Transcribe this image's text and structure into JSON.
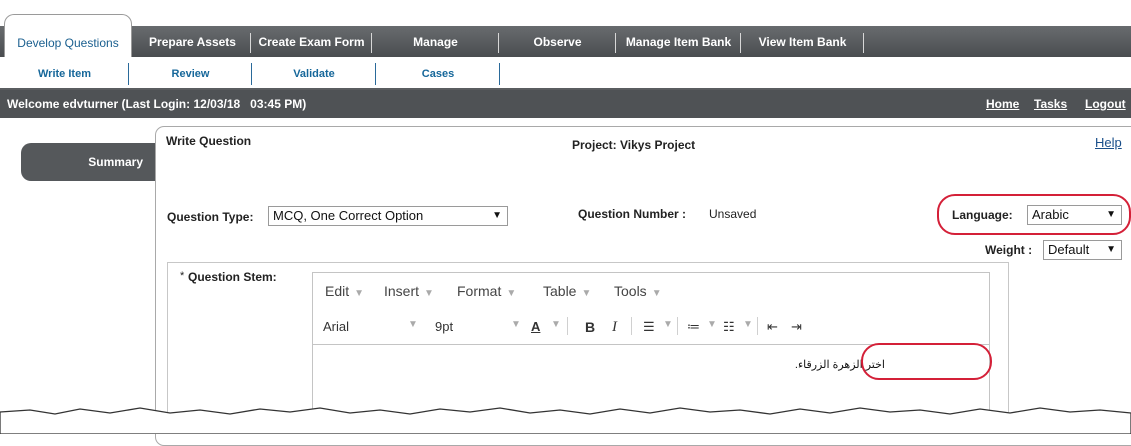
{
  "main_tabs": [
    {
      "label": "Develop Questions",
      "active": true
    },
    {
      "label": "Prepare Assets"
    },
    {
      "label": "Create Exam Form"
    },
    {
      "label": "Manage"
    },
    {
      "label": "Observe"
    },
    {
      "label": "Manage Item Bank"
    },
    {
      "label": "View Item Bank"
    }
  ],
  "sub_tabs": [
    {
      "label": "Write Item"
    },
    {
      "label": "Review"
    },
    {
      "label": "Validate"
    },
    {
      "label": "Cases"
    }
  ],
  "welcome": {
    "message": "Welcome edvturner (Last Login: 12/03/18   03:45 PM)",
    "links": [
      "Home",
      "Tasks",
      "Logout"
    ]
  },
  "sidebar": {
    "summary_label": "Summary"
  },
  "panel": {
    "title": "Write Question",
    "project": "Project: Vikys Project",
    "help_label": "Help",
    "question_type_label": "Question Type:",
    "question_type_value": "MCQ, One Correct Option",
    "question_number_label": "Question Number :",
    "question_number_value": "Unsaved",
    "language_label": "Language:",
    "language_value": "Arabic",
    "weight_label": "Weight :",
    "weight_value": "Default"
  },
  "stem": {
    "required_mark": "*",
    "label": "Question Stem:"
  },
  "editor": {
    "menus": [
      "Edit",
      "Insert",
      "Format",
      "Table",
      "Tools"
    ],
    "font_family": "Arial",
    "font_size": "9pt",
    "content": "اختر الزهرة الزرقاء."
  },
  "colors": {
    "highlight_oval": "#d42038",
    "tab_strip": "#55585b",
    "link_blue": "#16679a"
  }
}
